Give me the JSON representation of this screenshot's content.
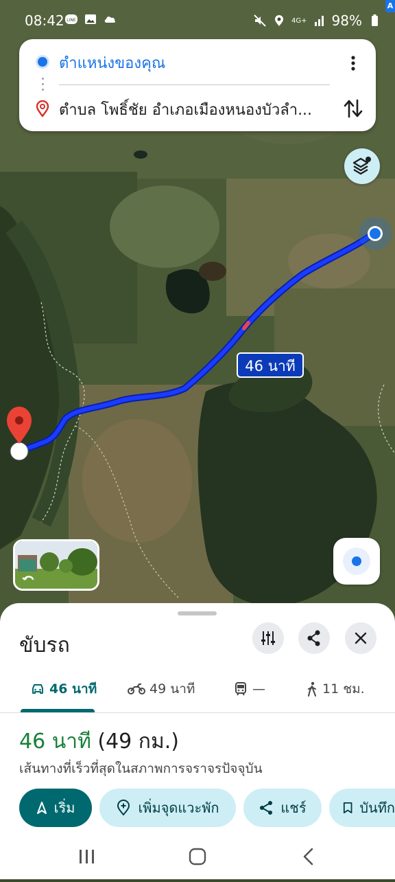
{
  "status_bar": {
    "time": "08:42",
    "battery": "98%",
    "network": "4G+",
    "left_icons": [
      "line-icon",
      "image-icon",
      "cloud-icon"
    ],
    "right_icons": [
      "mute-icon",
      "location-icon",
      "signal-icon",
      "battery-icon"
    ]
  },
  "search": {
    "origin": "ตำแหน่งของคุณ",
    "destination": "ตำบล โพธิ์ชัย อำเภอเมืองหนองบัวลำ..."
  },
  "map": {
    "route_label": "46 นาที",
    "route_color": "#1a3cff",
    "origin_color": "#1a73e8",
    "destination_color": "#ea4335"
  },
  "sheet": {
    "title": "ขับรถ",
    "tabs": [
      {
        "icon": "car-icon",
        "label": "46 นาที"
      },
      {
        "icon": "motorcycle-icon",
        "label": "49 นาที"
      },
      {
        "icon": "train-icon",
        "label": "—"
      },
      {
        "icon": "walk-icon",
        "label": "11 ชม."
      }
    ],
    "duration": "46 นาที",
    "distance": "(49 กม.)",
    "subtitle": "เส้นทางที่เร็วที่สุดในสภาพการจราจรปัจจุบัน",
    "actions": {
      "start": "เริ่ม",
      "add_stop": "เพิ่มจุดแวะพัก",
      "share": "แชร์",
      "save": "บันทึก"
    }
  },
  "colors": {
    "accent": "#00696f",
    "duration_green": "#188038",
    "chip_bg": "#cdeef5"
  }
}
